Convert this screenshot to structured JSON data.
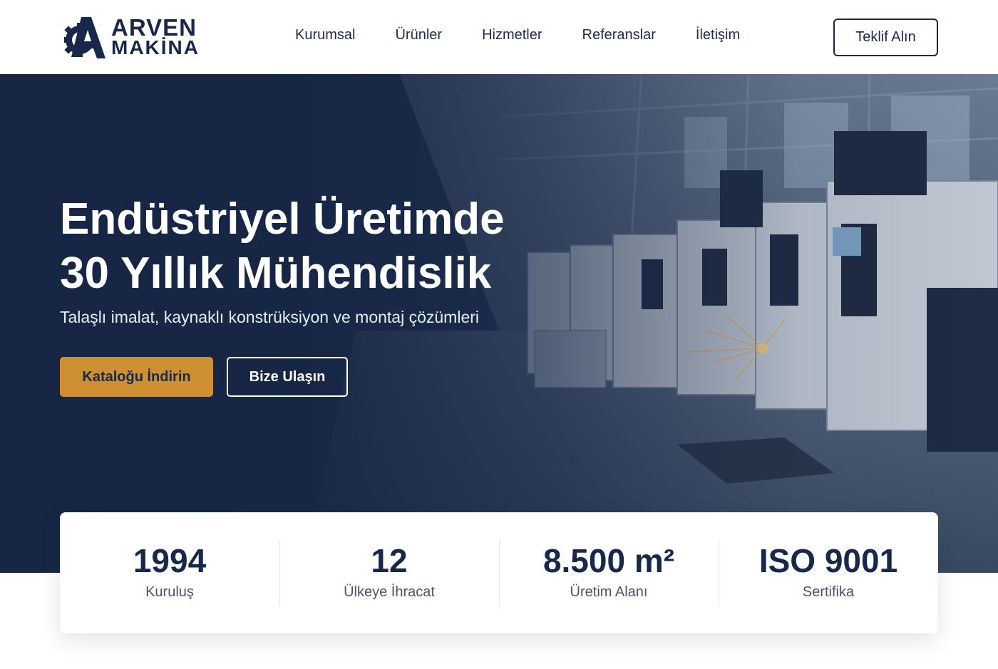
{
  "brand": {
    "line1": "ARVEN",
    "line2": "MAKİNA",
    "icon": "gear-a-logo-icon",
    "color": "#17284a"
  },
  "nav": {
    "items": [
      "Kurumsal",
      "Ürünler",
      "Hizmetler",
      "Referanslar",
      "İletişim"
    ]
  },
  "header": {
    "cta_label": "Teklif Alın"
  },
  "hero": {
    "title_line1": "Endüstriyel Üretimde",
    "title_line2": "30 Yıllık Mühendislik",
    "subtitle": "Talaşlı imalat, kaynaklı konstrüksiyon ve montaj çözümleri",
    "primary_button": "Kataloğu İndirin",
    "secondary_button": "Bize Ulaşın",
    "background": "factory-cnc-machines-image"
  },
  "stats": [
    {
      "value": "1994",
      "label": "Kuruluş"
    },
    {
      "value": "12",
      "label": "Ülkeye İhracat"
    },
    {
      "value": "8.500 m²",
      "label": "Üretim Alanı"
    },
    {
      "value": "ISO 9001",
      "label": "Sertifika"
    }
  ],
  "colors": {
    "navy": "#172a4a",
    "accent": "#cf8f33",
    "white": "#ffffff"
  }
}
